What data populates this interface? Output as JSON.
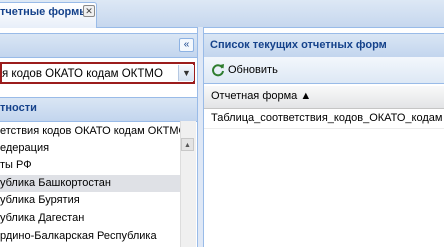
{
  "tab": {
    "title": "тчетные формы"
  },
  "left_panel": {
    "combo_value": "я кодов ОКАТО кодам ОКТМО",
    "tree_header": "тности",
    "tree_items": [
      "етствия кодов ОКАТО кодам ОКТМО",
      "едерация",
      "ты РФ",
      "ублика Башкортостан",
      "ублика Бурятия",
      "ублика Дагестан",
      "рдино-Балкарская Республика"
    ],
    "selected_index": 3
  },
  "right_panel": {
    "title": "Список текущих отчетных форм",
    "refresh_label": "Обновить",
    "column_header": "Отчетная форма ▲",
    "rows": [
      "Таблица_соответствия_кодов_ОКАТО_кодам"
    ]
  }
}
